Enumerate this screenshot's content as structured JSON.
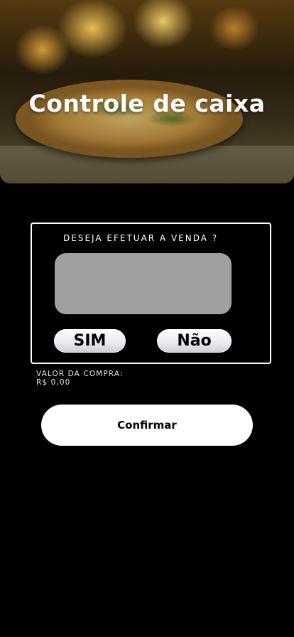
{
  "header": {
    "title": "Controle de caixa"
  },
  "dialog": {
    "question": "DESEJA EFETUAR A VENDA ?",
    "display_value": "",
    "yes_label": "SIM",
    "no_label": "Não"
  },
  "purchase": {
    "label": "VALOR DA COMPRA:",
    "value": "R$ 0,00"
  },
  "actions": {
    "confirm_label": "Confirmar"
  },
  "colors": {
    "background": "#000000",
    "display_box": "#a0a0a0",
    "button": "#ffffff",
    "text_light": "#ffffff"
  }
}
